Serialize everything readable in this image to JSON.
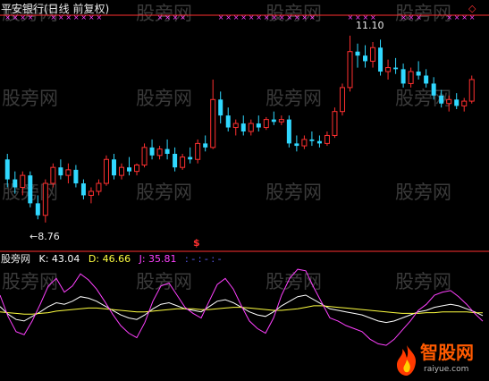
{
  "window": {
    "title": "平安银行(日线 前复权)",
    "low_price_label": "←8.76",
    "high_price_label": "11.10",
    "dollar_marker": "$",
    "corner_marker": "◇"
  },
  "indicator": {
    "name": "股旁网",
    "k_text": "K: 43.04",
    "d_text": "D: 46.66",
    "j_text": "J: 35.81",
    "extra_text": ": - : - : -"
  },
  "watermarks": [
    "股旁网",
    "股旁网",
    "股旁网",
    "股旁网",
    "股旁网",
    "股旁网",
    "股旁网",
    "股旁网",
    "股旁网",
    "股旁网",
    "股旁网",
    "股旁网",
    "股旁网",
    "股旁网",
    "股旁网",
    "股旁网"
  ],
  "logo": {
    "text": "智股网",
    "url": "raiyue.com"
  },
  "colors": {
    "up": "#ff3030",
    "down": "#30d8ff",
    "k_line": "#ffffff",
    "d_line": "#ffff40",
    "j_line": "#ff40ff",
    "separator": "#ff3030",
    "x_marker": "#ff40ff"
  },
  "chart_data": [
    {
      "type": "candlestick",
      "title": "平安银行(日线 前复权)",
      "y_range": [
        8.5,
        11.3
      ],
      "candles": [
        [
          9.55,
          9.62,
          9.2,
          9.3
        ],
        [
          9.3,
          9.4,
          9.12,
          9.2
        ],
        [
          9.2,
          9.4,
          9.1,
          9.35
        ],
        [
          9.35,
          9.4,
          8.95,
          9.0
        ],
        [
          9.0,
          9.1,
          8.8,
          8.85
        ],
        [
          8.85,
          9.3,
          8.76,
          9.25
        ],
        [
          9.25,
          9.5,
          9.2,
          9.45
        ],
        [
          9.45,
          9.55,
          9.3,
          9.35
        ],
        [
          9.35,
          9.5,
          9.25,
          9.42
        ],
        [
          9.42,
          9.48,
          9.2,
          9.25
        ],
        [
          9.25,
          9.3,
          9.05,
          9.1
        ],
        [
          9.1,
          9.2,
          9.0,
          9.15
        ],
        [
          9.15,
          9.3,
          9.1,
          9.25
        ],
        [
          9.25,
          9.6,
          9.22,
          9.55
        ],
        [
          9.55,
          9.62,
          9.3,
          9.35
        ],
        [
          9.35,
          9.5,
          9.3,
          9.45
        ],
        [
          9.45,
          9.58,
          9.35,
          9.4
        ],
        [
          9.4,
          9.5,
          9.35,
          9.48
        ],
        [
          9.48,
          9.75,
          9.45,
          9.7
        ],
        [
          9.7,
          9.8,
          9.55,
          9.6
        ],
        [
          9.6,
          9.72,
          9.55,
          9.68
        ],
        [
          9.68,
          9.8,
          9.55,
          9.62
        ],
        [
          9.62,
          9.7,
          9.4,
          9.45
        ],
        [
          9.45,
          9.62,
          9.42,
          9.58
        ],
        [
          9.58,
          9.7,
          9.5,
          9.55
        ],
        [
          9.55,
          9.8,
          9.5,
          9.75
        ],
        [
          9.75,
          9.85,
          9.65,
          9.7
        ],
        [
          9.7,
          10.55,
          9.68,
          10.3
        ],
        [
          10.3,
          10.4,
          10.0,
          10.1
        ],
        [
          10.1,
          10.2,
          9.9,
          9.95
        ],
        [
          9.95,
          10.05,
          9.85,
          10.0
        ],
        [
          10.0,
          10.1,
          9.85,
          9.9
        ],
        [
          9.9,
          10.05,
          9.85,
          10.0
        ],
        [
          10.0,
          10.1,
          9.9,
          9.95
        ],
        [
          9.95,
          10.08,
          9.92,
          10.05
        ],
        [
          10.05,
          10.15,
          9.98,
          10.02
        ],
        [
          10.02,
          10.1,
          9.98,
          10.05
        ],
        [
          10.05,
          10.1,
          9.7,
          9.75
        ],
        [
          9.75,
          9.85,
          9.65,
          9.72
        ],
        [
          9.72,
          9.85,
          9.68,
          9.8
        ],
        [
          9.8,
          9.9,
          9.72,
          9.78
        ],
        [
          9.78,
          9.85,
          9.7,
          9.75
        ],
        [
          9.75,
          9.9,
          9.72,
          9.85
        ],
        [
          9.85,
          10.2,
          9.82,
          10.15
        ],
        [
          10.15,
          10.5,
          10.1,
          10.45
        ],
        [
          10.45,
          11.1,
          10.4,
          10.9
        ],
        [
          10.9,
          11.0,
          10.7,
          10.85
        ],
        [
          10.85,
          10.98,
          10.7,
          10.78
        ],
        [
          10.78,
          11.02,
          10.7,
          10.95
        ],
        [
          10.95,
          11.05,
          10.6,
          10.65
        ],
        [
          10.65,
          10.8,
          10.55,
          10.7
        ],
        [
          10.7,
          10.82,
          10.62,
          10.68
        ],
        [
          10.68,
          10.75,
          10.45,
          10.5
        ],
        [
          10.5,
          10.7,
          10.45,
          10.65
        ],
        [
          10.65,
          10.78,
          10.55,
          10.6
        ],
        [
          10.6,
          10.68,
          10.45,
          10.5
        ],
        [
          10.5,
          10.58,
          10.3,
          10.35
        ],
        [
          10.35,
          10.42,
          10.2,
          10.25
        ],
        [
          10.25,
          10.35,
          10.15,
          10.3
        ],
        [
          10.3,
          10.38,
          10.18,
          10.22
        ],
        [
          10.22,
          10.32,
          10.15,
          10.28
        ],
        [
          10.28,
          10.6,
          10.25,
          10.55
        ]
      ],
      "annotations": [
        "←8.76",
        "11.10"
      ]
    },
    {
      "type": "line",
      "title": "股旁网",
      "y_range": [
        -10,
        110
      ],
      "series": [
        {
          "name": "K",
          "values": [
            55,
            45,
            38,
            36,
            42,
            48,
            55,
            60,
            58,
            62,
            68,
            66,
            62,
            56,
            50,
            44,
            40,
            38,
            44,
            52,
            58,
            60,
            56,
            52,
            50,
            48,
            55,
            62,
            64,
            60,
            54,
            48,
            44,
            42,
            48,
            56,
            62,
            68,
            70,
            64,
            58,
            52,
            50,
            48,
            46,
            44,
            40,
            36,
            34,
            36,
            40,
            44,
            48,
            50,
            54,
            56,
            58,
            56,
            52,
            48,
            43
          ]
        },
        {
          "name": "D",
          "values": [
            48,
            47,
            46,
            45,
            45,
            46,
            47,
            49,
            50,
            51,
            52,
            53,
            53,
            52,
            51,
            50,
            49,
            48,
            48,
            49,
            50,
            51,
            52,
            52,
            52,
            51,
            51,
            52,
            53,
            54,
            54,
            53,
            52,
            51,
            50,
            50,
            51,
            52,
            54,
            56,
            56,
            55,
            54,
            53,
            52,
            51,
            50,
            49,
            48,
            47,
            46,
            46,
            46,
            47,
            47,
            48,
            48,
            48,
            48,
            47,
            46.66
          ]
        },
        {
          "name": "J",
          "values": [
            70,
            42,
            22,
            18,
            36,
            58,
            82,
            92,
            74,
            82,
            98,
            90,
            78,
            62,
            45,
            30,
            20,
            14,
            34,
            62,
            82,
            86,
            70,
            54,
            46,
            40,
            62,
            84,
            92,
            78,
            56,
            36,
            26,
            20,
            40,
            70,
            92,
            104,
            102,
            80,
            60,
            40,
            36,
            30,
            26,
            22,
            12,
            6,
            4,
            12,
            24,
            36,
            50,
            58,
            70,
            74,
            76,
            68,
            58,
            46,
            35.81
          ]
        }
      ]
    }
  ]
}
